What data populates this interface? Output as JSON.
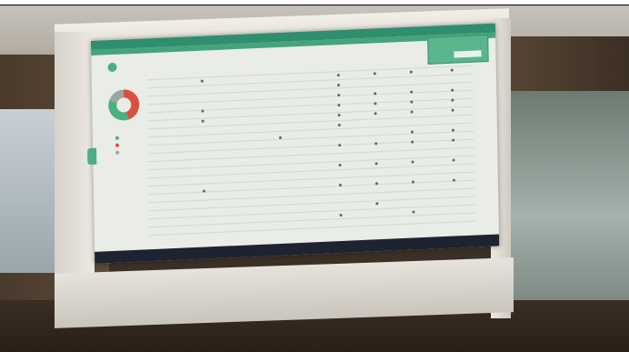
{
  "scene": {
    "subject": "projection-screen",
    "projected_app": {
      "accent_color": "#2f8e6e",
      "status_colors": {
        "green": "#4bb07f",
        "red": "#d8503e",
        "grey": "#9aa79f"
      }
    }
  }
}
